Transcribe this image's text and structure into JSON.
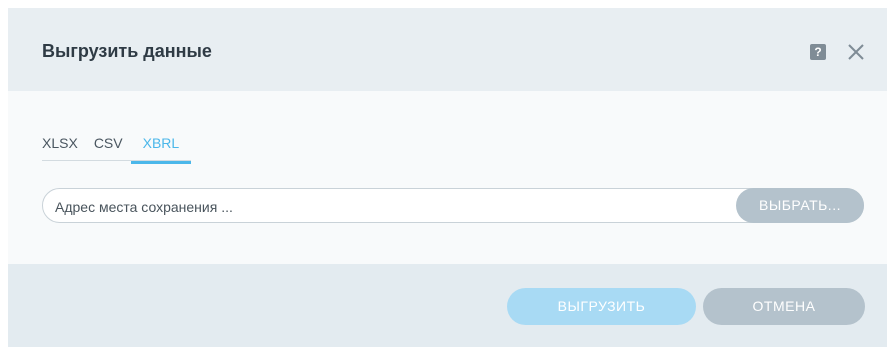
{
  "dialog": {
    "title": "Выгрузить данные",
    "help_icon": "question-mark-icon",
    "help_label": "?",
    "close_icon": "close-icon"
  },
  "tabs": [
    {
      "label": "XLSX",
      "active": false
    },
    {
      "label": "CSV",
      "active": false
    },
    {
      "label": "XBRL",
      "active": true
    }
  ],
  "path": {
    "placeholder": "Адрес места сохранения ...",
    "value": "",
    "choose_label": "ВЫБРАТЬ..."
  },
  "footer": {
    "export_label": "ВЫГРУЗИТЬ",
    "cancel_label": "ОТМЕНА"
  },
  "colors": {
    "accent": "#4bb7ea",
    "header_bg": "#e8eef2",
    "footer_bg": "#e3ebf0",
    "button_gray": "#b4c2cc",
    "button_disabled_accent": "#a8daf4"
  }
}
